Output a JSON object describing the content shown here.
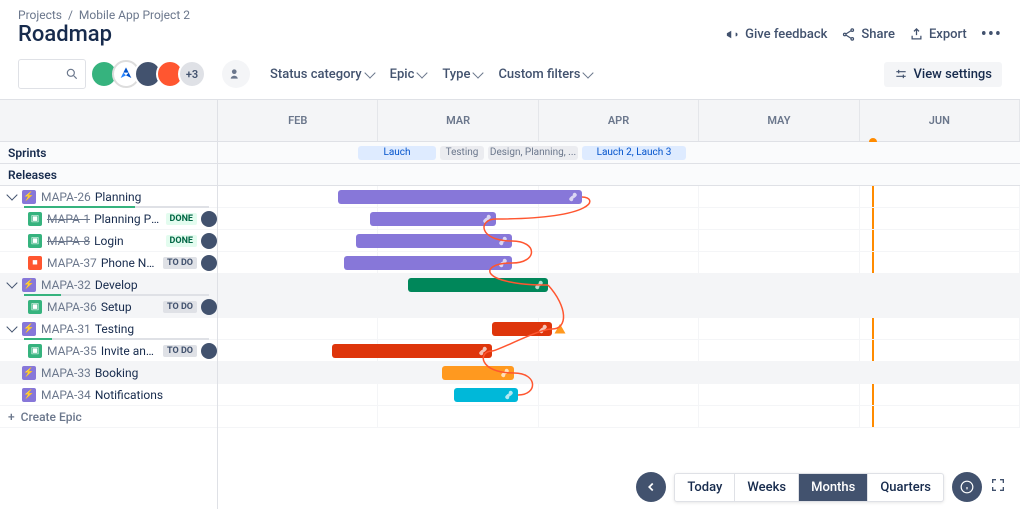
{
  "breadcrumb": {
    "root": "Projects",
    "project": "Mobile App Project 2"
  },
  "title": "Roadmap",
  "actions": {
    "feedback": "Give feedback",
    "share": "Share",
    "export": "Export"
  },
  "avatars_more": "+3",
  "filters": {
    "status": "Status category",
    "epic": "Epic",
    "type": "Type",
    "custom": "Custom filters"
  },
  "view_settings": "View settings",
  "months": [
    "FEB",
    "MAR",
    "APR",
    "MAY",
    "JUN"
  ],
  "sections": {
    "sprints": "Sprints",
    "releases": "Releases"
  },
  "sprints": [
    {
      "label": "Lauch",
      "style": "blue"
    },
    {
      "label": "Testing",
      "style": "gray"
    },
    {
      "label": "Design, Planning, ...",
      "style": "gray"
    },
    {
      "label": "Lauch 2, Lauch 3",
      "style": "blue"
    }
  ],
  "epics": [
    {
      "key": "MAPA-26",
      "summary": "Planning",
      "icon": "epic",
      "progress": 60,
      "children": [
        {
          "key": "MAPA-1",
          "summary": "Planning Proje...",
          "icon": "story",
          "status": "DONE",
          "done": true
        },
        {
          "key": "MAPA-8",
          "summary": "Login",
          "icon": "story",
          "status": "DONE",
          "done": true
        },
        {
          "key": "MAPA-37",
          "summary": "Phone Num...",
          "icon": "bug",
          "status": "TO DO"
        }
      ]
    },
    {
      "key": "MAPA-32",
      "summary": "Develop",
      "icon": "epic",
      "progress": 20,
      "alt": true,
      "children": [
        {
          "key": "MAPA-36",
          "summary": "Setup",
          "icon": "story",
          "status": "TO DO"
        }
      ]
    },
    {
      "key": "MAPA-31",
      "summary": "Testing",
      "icon": "epic",
      "progress": 15,
      "children": [
        {
          "key": "MAPA-35",
          "summary": "Invite and S...",
          "icon": "story",
          "status": "TO DO"
        }
      ]
    },
    {
      "key": "MAPA-33",
      "summary": "Booking",
      "icon": "epic",
      "alt": true
    },
    {
      "key": "MAPA-34",
      "summary": "Notifications",
      "icon": "epic"
    }
  ],
  "create": "Create Epic",
  "zoom": {
    "today": "Today",
    "weeks": "Weeks",
    "months": "Months",
    "quarters": "Quarters",
    "active": "months"
  },
  "colors": {
    "epic": "#8777d9",
    "green": "#00875a",
    "red": "#de350b",
    "orange": "#ff991f",
    "cyan": "#00b8d9"
  }
}
